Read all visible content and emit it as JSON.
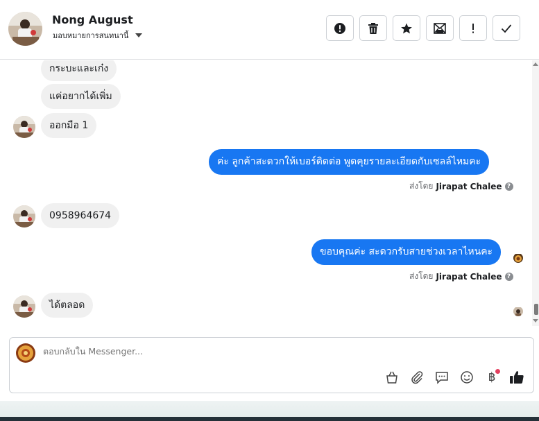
{
  "header": {
    "contact_name": "Nong August",
    "assign_label": "มอบหมายการสนทนานี้"
  },
  "messages": [
    {
      "dir": "in",
      "text": "กระบะและเก๋ง"
    },
    {
      "dir": "in",
      "text": "แค่อยากได้เพิ่ม"
    },
    {
      "dir": "in",
      "text": "ออกมือ 1"
    },
    {
      "dir": "out",
      "text": "ค่ะ ลูกค้าสะดวกให้เบอร์ติดต่อ พูดคุยรายละเอียดกับเซลล์ไหมคะ"
    },
    {
      "dir": "in",
      "text": "0958964674"
    },
    {
      "dir": "out",
      "text": "ขอบคุณค่ะ สะดวกรับสายช่วงเวลาไหนคะ"
    },
    {
      "dir": "in",
      "text": "ได้ตลอด"
    }
  ],
  "sent_by": {
    "prefix": "ส่งโดย",
    "agent": "Jirapat Chalee"
  },
  "composer": {
    "placeholder": "ตอบกลับใน Messenger..."
  },
  "colors": {
    "outgoing_bubble": "#1877f2",
    "incoming_bubble": "#f0f0f0"
  },
  "icons": {
    "actions": [
      "alert-circle-icon",
      "trash-icon",
      "star-icon",
      "mark-unread-icon",
      "exclamation-icon",
      "check-icon"
    ],
    "tools": [
      "bag-icon",
      "paperclip-icon",
      "chat-bubble-icon",
      "emoji-icon",
      "baht-icon",
      "thumbs-up-icon"
    ]
  }
}
